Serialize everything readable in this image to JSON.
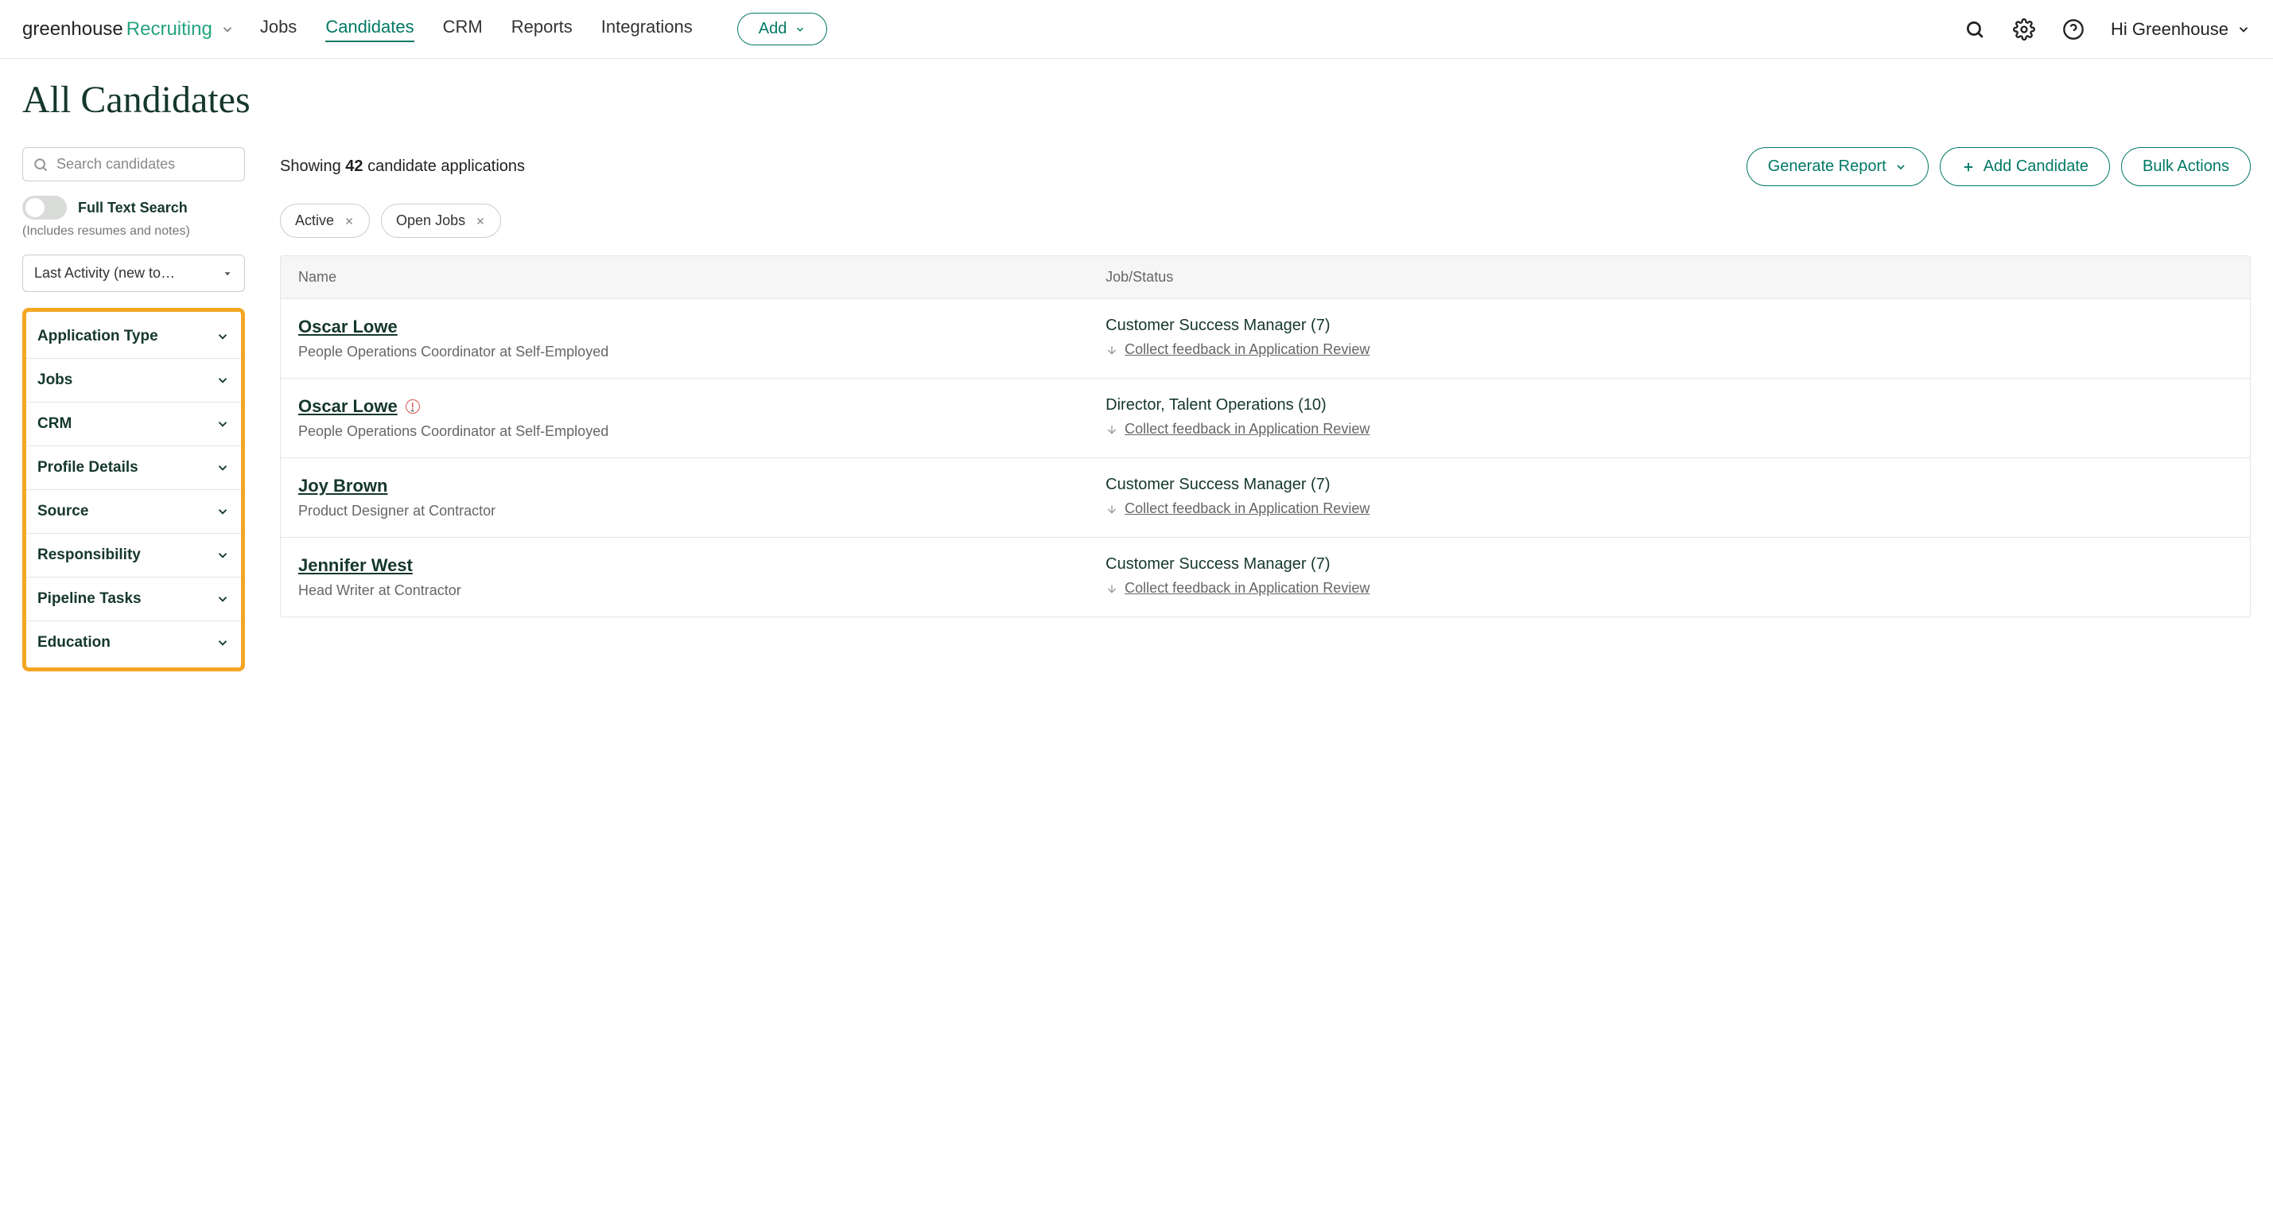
{
  "logo": {
    "part1": "greenhouse",
    "part2": "Recruiting"
  },
  "nav": {
    "items": [
      {
        "label": "Jobs"
      },
      {
        "label": "Candidates",
        "active": true
      },
      {
        "label": "CRM"
      },
      {
        "label": "Reports"
      },
      {
        "label": "Integrations"
      }
    ],
    "add": "Add",
    "user": "Hi Greenhouse"
  },
  "page_title": "All Candidates",
  "sidebar": {
    "search_placeholder": "Search candidates",
    "toggle_label": "Full Text Search",
    "toggle_sub": "(Includes resumes and notes)",
    "sort": "Last Activity (new to…",
    "filters": [
      "Application Type",
      "Jobs",
      "CRM",
      "Profile Details",
      "Source",
      "Responsibility",
      "Pipeline Tasks",
      "Education"
    ]
  },
  "main": {
    "showing_prefix": "Showing ",
    "showing_count": "42",
    "showing_suffix": " candidate applications",
    "generate_report": "Generate Report",
    "add_candidate": "Add Candidate",
    "bulk_actions": "Bulk Actions",
    "chips": [
      "Active",
      "Open Jobs"
    ],
    "columns": {
      "name": "Name",
      "job": "Job/Status"
    },
    "feedback_text": "Collect feedback in Application Review",
    "rows": [
      {
        "name": "Oscar Lowe",
        "sub": "People Operations Coordinator at Self-Employed",
        "job": "Customer Success Manager (7)",
        "alert": false
      },
      {
        "name": "Oscar Lowe",
        "sub": "People Operations Coordinator at Self-Employed",
        "job": "Director, Talent Operations (10)",
        "alert": true
      },
      {
        "name": "Joy Brown",
        "sub": "Product Designer at Contractor",
        "job": "Customer Success Manager (7)",
        "alert": false
      },
      {
        "name": "Jennifer West",
        "sub": "Head Writer at Contractor",
        "job": "Customer Success Manager (7)",
        "alert": false
      }
    ]
  }
}
